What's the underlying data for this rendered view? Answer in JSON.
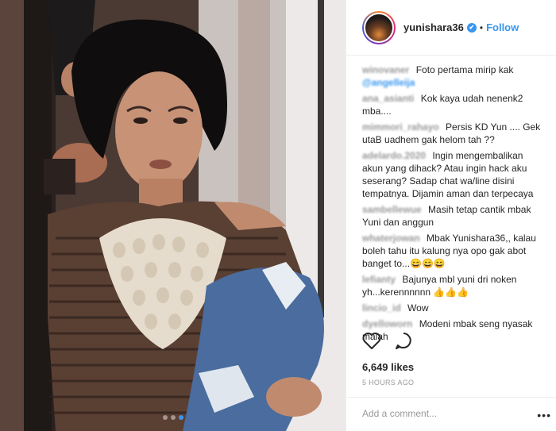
{
  "post": {
    "username": "yunishara36",
    "verified_mark": "✔",
    "separator": "•",
    "follow_label": "Follow",
    "likes": "6,649 likes",
    "time": "5 HOURS AGO",
    "add_comment_placeholder": "Add a comment...",
    "more_label": "•••"
  },
  "comments": [
    {
      "user": "winovaner",
      "text": "Foto pertama mirip kak"
    },
    {
      "user": "@angelleija",
      "text": ""
    },
    {
      "user": "ana_asianti",
      "text": "Kok kaya udah nenenk2 mba...."
    },
    {
      "user": "mimmori_rahayo",
      "text": "Persis KD Yun .... Gek utaB uadhem gak helom tah ??"
    },
    {
      "user": "adelardo.2020",
      "text": "Ingin mengembalikan akun yang dihack? Atau ingin hack aku seserang? Sadap chat wa/line disini tempatnya. Dijamin aman dan terpecaya"
    },
    {
      "user": "sambellewue",
      "text": "Masih tetap cantik mbak Yuni dan anggun"
    },
    {
      "user": "whaterjowan",
      "text": "Mbak Yunishara36,, kalau boleh tahu itu kalung nya opo gak abot banget to...😄😄😄"
    },
    {
      "user": "lefianty",
      "text": "Bajunya mbl yuni dri noken yh...kerennnnnn 👍👍👍"
    },
    {
      "user": "lincio_id",
      "text": "Wow"
    },
    {
      "user": "dyelloworn",
      "text": "Modeni mbak seng nyasak malah"
    }
  ],
  "icons": {
    "heart": "heart-icon",
    "comment": "comment-icon",
    "verified": "verified-badge-icon"
  },
  "colors": {
    "accent": "#3897f0",
    "muted": "#999999",
    "text": "#262626"
  }
}
